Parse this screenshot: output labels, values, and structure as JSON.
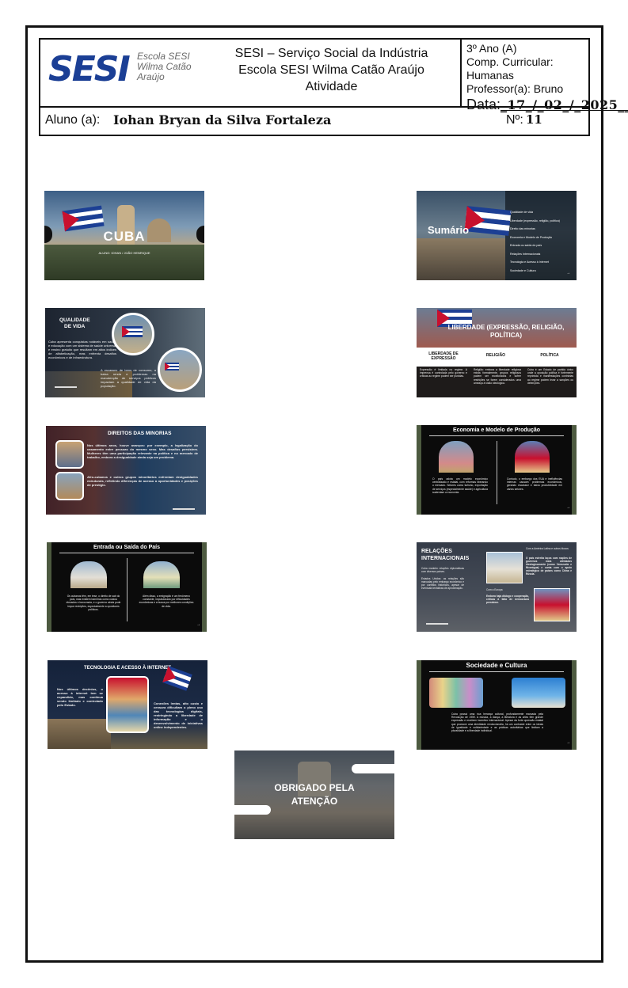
{
  "header": {
    "logo_text": "SESI",
    "logo_side_lines": [
      "Escola SESI",
      "Wilma Catão",
      "Araújo"
    ],
    "institution_lines": [
      "SESI – Serviço Social da Indústria",
      "Escola SESI Wilma Catão Araújo",
      "Atividade"
    ],
    "grade": "3º Ano (A)",
    "component": "Comp. Curricular: Humanas",
    "teacher": "Professor(a):  Bruno",
    "date_label": "Data:",
    "date_value": "_17_/_02_/_2025___",
    "student_label": "Aluno (a):",
    "student_name": "Iohan Bryan da Silva Fortaleza",
    "number_label": "Nº:",
    "number_value": "11"
  },
  "slides": {
    "cuba": {
      "title": "CUBA",
      "subtitle": "ALUNO: IOHAN / JOÃO HENRIQUE"
    },
    "sumario": {
      "title": "Sumário",
      "items": [
        "Qualidade de vida",
        "Liberdade (expressão, religião, política)",
        "Direito das minorias",
        "Economia e Modelo de Produção",
        "Entrada ou saída do país",
        "Relações Internacionais",
        "Tecnologia e Acesso à Internet",
        "Sociedade e Cultura"
      ]
    },
    "qualidade": {
      "title_line1": "QUALIDADE",
      "title_line2": "DE VIDA",
      "text1": "Cuba apresenta conquistas notáveis em saúde e educação com um sistema de saúde universal e ensino gratuito que resultam em altos índices de alfabetização, mas enfrenta desafios econômicos e de infraestrutura.",
      "text2": "A escassez de bens de consumo, a baixa renda e problemas na manutenção de serviços públicos impactam a qualidade de vida da população."
    },
    "liberdade": {
      "title": "LIBERDADE (EXPRESSÃO, RELIGIÃO, POLÍTICA)",
      "col1_head": "LIBERDADE DE EXPRESSÃO",
      "col2_head": "RELIGIÃO",
      "col3_head": "POLÍTICA",
      "col1_text": "Expressão é limitada no regime. A imprensa é controlada pelo governo e críticas ao regime podem ser punidas.",
      "col2_text": "Religião: embora a liberdade religiosa exista formalmente, grupos religiosos podem ser monitorados e sofrer restrições se forem considerados uma ameaça à visão ideológica.",
      "col3_text": "Cuba é um Estado de partido único onde a oposição política é fortemente reprimida e manifestações contrárias ao regime podem levar a sanções ou detenções."
    },
    "minorias": {
      "title": "DIREITOS DAS MINORIAS",
      "text1": "Nos últimos anos, houve avanços: por exemplo, a legalização do casamento entre pessoas do mesmo sexo. Mas desafios persistem. Mulheres têm uma participação relevante na política e no mercado de trabalho, embora a desigualdade ainda seja um problema.",
      "text2": "Afro-cubanos e outros grupos minoritários enfrentam desigualdades estruturais, refletindo diferenças de acesso a oportunidades e posições de prestígio."
    },
    "economia": {
      "title": "Economia e Modelo de Produção",
      "text1": "O país adota um modelo econômico centralizado e estatal, com reformas liberando o mercado. Setores como turismo, exportação de serviços (especialmente saúde) e agricultura sustentam a economia.",
      "text2": "Contudo, o embargo dos EUA e ineficiências internas causam problemas econômicos, gerando escassez e baixa produtividade em vários setores."
    },
    "entrada": {
      "title": "Entrada ou Saída do País",
      "text1": "Os cubanos têm, em tese, o direito de sair do país, mas existem barreiras como custos elevados e burocracia, e o governo ainda pode impor restrições, especialmente a opositores políticos.",
      "text2": "Além disso, a emigração é um fenômeno constante, impulsionado por dificuldades econômicas e a busca por melhores condições de vida."
    },
    "relacoes": {
      "title_line1": "RELAÇÕES",
      "title_line2": "INTERNACIONAIS",
      "text1": "Cuba mantém relações diplomáticas com diversos países.",
      "text2": "Estados Unidos: as relações são marcadas pelo embargo econômico e por conflitos históricos, apesar de eventuais tentativas de aproximação.",
      "text3": "Com a América Latina e outros blocos",
      "text4": "O país estreita laços com nações de governos mais alinhados ideologicamente (como Venezuela e Nicarágua) e conta com o apoio estratégico de países como China e Rússia.",
      "text5": "Com a Europa",
      "text6": "Embora haja diálogo e cooperação, críticas à falta de democracia persistem."
    },
    "tecnologia": {
      "title": "TECNOLOGIA E ACESSO À INTERNET",
      "text1": "Nos últimos decênios, o acesso à internet tem se expandido, mas continua sendo limitado e controlado pelo Estado.",
      "text2": "Conexões lentas, alto custo e censura dificultam o pleno uso das tecnologias digitais, restringindo a liberdade de informação e o desenvolvimento de iniciativas online independentes."
    },
    "sociedade": {
      "title": "Sociedade e Cultura",
      "text": "Cuba possui uma rica herança cultural, profundamente marcada pela Revolução de 1959. A música, a dança, a literatura e as artes têm grande expressão e recebem incentivo internacional. Apesar da forte opressão estatal que promove uma identidade revolucionária, há um contraste entre os ideais de igualdade e solidariedade e as práticas autoritárias que limitam a pluralidade e a liberdade individual."
    },
    "obrigado": {
      "title_line1": "OBRIGADO PELA",
      "title_line2": "ATENÇÃO"
    }
  },
  "colors": {
    "brand_blue": "#1b3f95",
    "flag_red": "#c8102e",
    "flag_blue": "#1c3f94"
  }
}
